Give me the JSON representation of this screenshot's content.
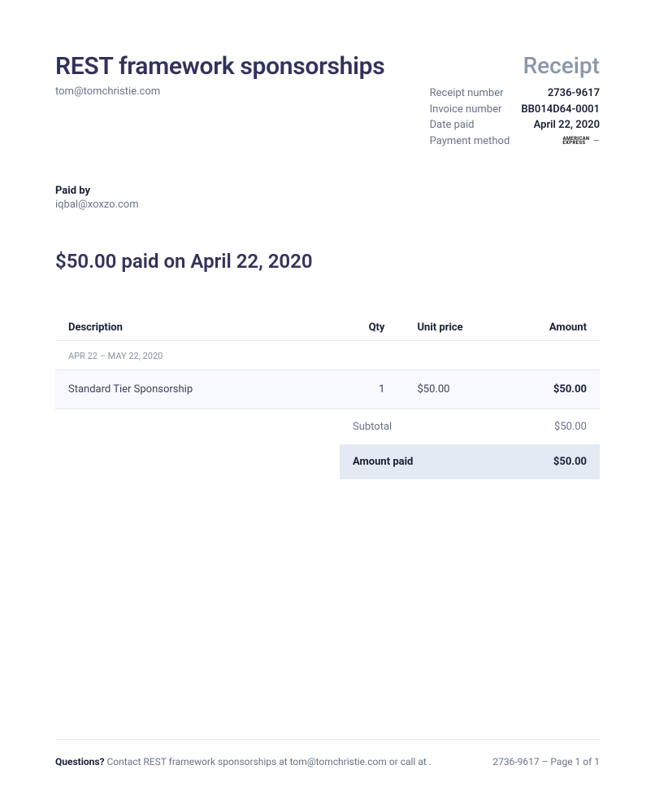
{
  "header": {
    "title": "REST framework sponsorships",
    "receipt_label": "Receipt",
    "from_email": "tom@tomchristie.com"
  },
  "meta": {
    "receipt_number_label": "Receipt number",
    "receipt_number": "2736-9617",
    "invoice_number_label": "Invoice number",
    "invoice_number": "BB014D64-0001",
    "date_paid_label": "Date paid",
    "date_paid": "April 22, 2020",
    "payment_method_label": "Payment method",
    "payment_method_brand_line1": "AMERICAN",
    "payment_method_brand_line2": "EXPRESS",
    "payment_method_suffix": "–"
  },
  "paid_by": {
    "label": "Paid by",
    "email": "iqbal@xoxzo.com"
  },
  "summary": "$50.00 paid on April 22, 2020",
  "table": {
    "headers": {
      "description": "Description",
      "qty": "Qty",
      "unit_price": "Unit price",
      "amount": "Amount"
    },
    "period": "APR 22 – MAY 22, 2020",
    "items": [
      {
        "description": "Standard Tier Sponsorship",
        "qty": "1",
        "unit_price": "$50.00",
        "amount": "$50.00"
      }
    ],
    "subtotal_label": "Subtotal",
    "subtotal": "$50.00",
    "amount_paid_label": "Amount paid",
    "amount_paid": "$50.00"
  },
  "footer": {
    "questions_label": "Questions?",
    "contact_text": " Contact REST framework sponsorships at tom@tomchristie.com or call at .",
    "page_info": "2736-9617 – Page 1 of 1"
  }
}
